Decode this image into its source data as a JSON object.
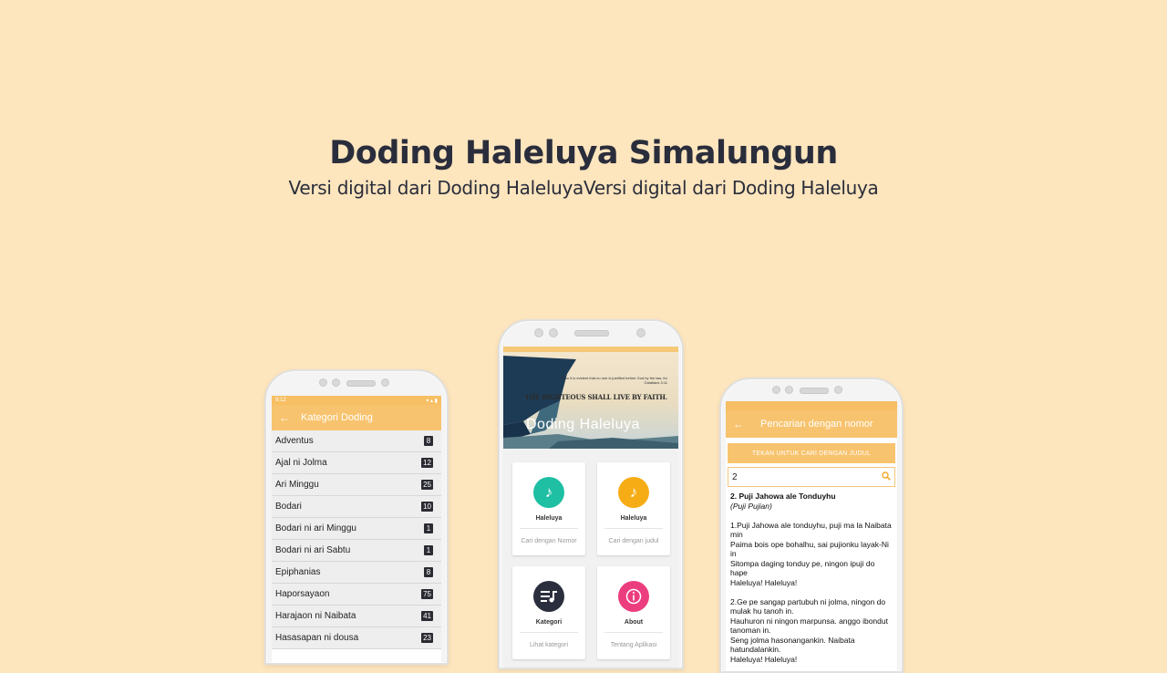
{
  "hero": {
    "title": "Doding Haleluya Simalungun",
    "subtitle": "Versi digital dari Doding HaleluyaVersi digital dari Doding Haleluya"
  },
  "colors": {
    "background": "#fde5bd",
    "accent": "#f8c36e",
    "teal": "#1ebfa3",
    "amber": "#f6ad15",
    "navy": "#2b2f3d",
    "pink": "#ec3d7e"
  },
  "left_phone": {
    "statusbar": {
      "left": "9:12",
      "right": "▾ ▴ ▮"
    },
    "appbar": {
      "back_icon": "arrow-left-icon",
      "title": "Kategori Doding"
    },
    "categories": [
      {
        "name": "Adventus",
        "count": "8"
      },
      {
        "name": "Ajal ni Jolma",
        "count": "12"
      },
      {
        "name": "Ari Minggu",
        "count": "25"
      },
      {
        "name": "Bodari",
        "count": "10"
      },
      {
        "name": "Bodari ni ari Minggu",
        "count": "1"
      },
      {
        "name": "Bodari ni ari Sabtu",
        "count": "1"
      },
      {
        "name": "Epiphanias",
        "count": "8"
      },
      {
        "name": "Haporsayaon",
        "count": "75"
      },
      {
        "name": "Harajaon ni Naibata",
        "count": "41"
      },
      {
        "name": "Hasasapan ni dousa",
        "count": "23"
      }
    ]
  },
  "center_phone": {
    "banner": {
      "small_text": "Thou it is evident that no one is justified before God by the law, for Galatians 3:11",
      "quote": "THE RIGHTEOUS SHALL LIVE BY FAITH.",
      "app_name": "Doding Haleluya"
    },
    "cards": [
      {
        "icon": "music-note-icon",
        "label": "Haleluya",
        "sub": "Cari dengan Nomor",
        "color": "#1ebfa3"
      },
      {
        "icon": "music-note-icon",
        "label": "Haleluya",
        "sub": "Cari dengan judul",
        "color": "#f6ad15"
      },
      {
        "icon": "playlist-icon",
        "label": "Kategori",
        "sub": "Lihat kategori",
        "color": "#2b2f3d"
      },
      {
        "icon": "info-icon",
        "label": "About",
        "sub": "Tentang Aplikasi",
        "color": "#ec3d7e"
      }
    ]
  },
  "right_phone": {
    "appbar": {
      "back_icon": "arrow-left-icon",
      "title": "Pencarian dengan nomor"
    },
    "press_button": "TEKAN UNTUK CARI DENGAN JUDUL",
    "search": {
      "value": "2",
      "icon": "search-icon"
    },
    "song": {
      "title": "2. Puji Jahowa ale Tonduyhu",
      "category": "(Puji Pujian)",
      "verse1": [
        "1.Puji Jahowa ale tonduyhu, puji ma la Naibata min",
        "Paima bois ope bohalhu, sai pujionku layak-Ni in",
        "Sitompa daging tonduy pe, ningon ipuji do hape",
        "Haleluya! Haleluya!"
      ],
      "verse2": [
        "2.Ge pe sangap partubuh ni jolma, ningon do mulak hu tanoh in.",
        "Hauhuron ni ningon marpunsa. anggo ibondut tanoman in.",
        "Seng jolma hasonangankin. Naibata hatundalankin.",
        "Haleluya! Haleluya!"
      ]
    }
  }
}
